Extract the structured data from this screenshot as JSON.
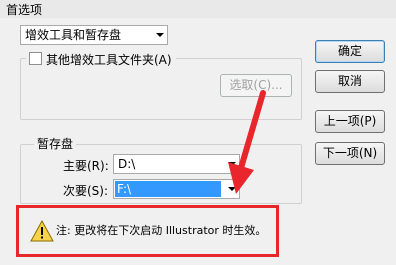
{
  "window": {
    "title": "首选项"
  },
  "section_selector": {
    "value": "增效工具和暂存盘"
  },
  "plugins": {
    "checkbox_label": "其他增效工具文件夹(A)",
    "choose_button": "选取(C)..."
  },
  "buttons": {
    "ok": "确定",
    "cancel": "取消",
    "prev": "上一项(P)",
    "next": "下一项(N)"
  },
  "scratch": {
    "group_title": "暂存盘",
    "primary_label": "主要(R):",
    "primary_value": "D:\\",
    "secondary_label": "次要(S):",
    "secondary_value": "F:\\"
  },
  "note": {
    "text": "注: 更改将在下次启动 Illustrator 时生效。"
  },
  "colors": {
    "highlight_red": "#e8262b",
    "selection_blue": "#3399ff"
  }
}
